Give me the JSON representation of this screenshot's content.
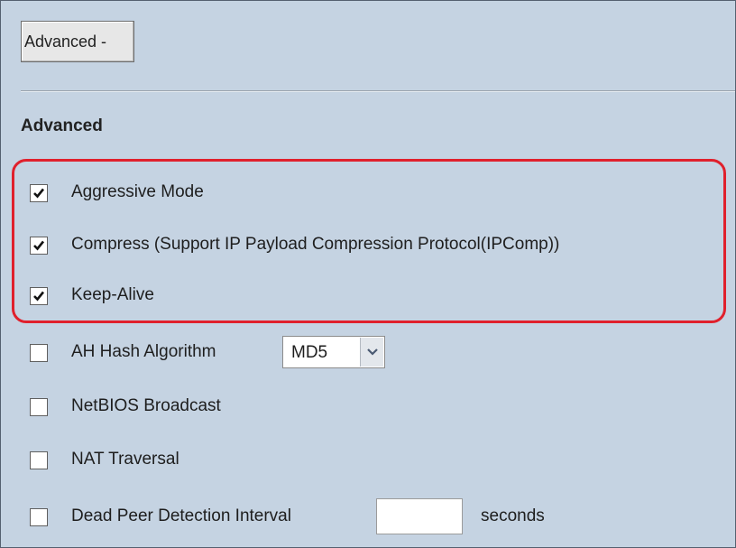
{
  "toggle_button": {
    "label": "Advanced -"
  },
  "section": {
    "title": "Advanced"
  },
  "options": [
    {
      "key": "aggressive_mode",
      "label": "Aggressive Mode",
      "checked": true
    },
    {
      "key": "compress",
      "label": "Compress (Support IP Payload Compression Protocol(IPComp))",
      "checked": true
    },
    {
      "key": "keep_alive",
      "label": "Keep-Alive",
      "checked": true
    },
    {
      "key": "ah_hash",
      "label": "AH Hash Algorithm",
      "checked": false,
      "select": {
        "value": "MD5",
        "arrow_icon": "chevron-down-icon"
      }
    },
    {
      "key": "netbios",
      "label": "NetBIOS Broadcast",
      "checked": false
    },
    {
      "key": "nat_traversal",
      "label": "NAT Traversal",
      "checked": false
    },
    {
      "key": "dpd",
      "label": "Dead Peer Detection Interval",
      "checked": false,
      "input": {
        "value": "",
        "unit": "seconds"
      }
    }
  ],
  "colors": {
    "panel_background": "#c5d3e2",
    "highlight_border": "#e0202c",
    "checkbox_border": "#5f5f5f"
  }
}
